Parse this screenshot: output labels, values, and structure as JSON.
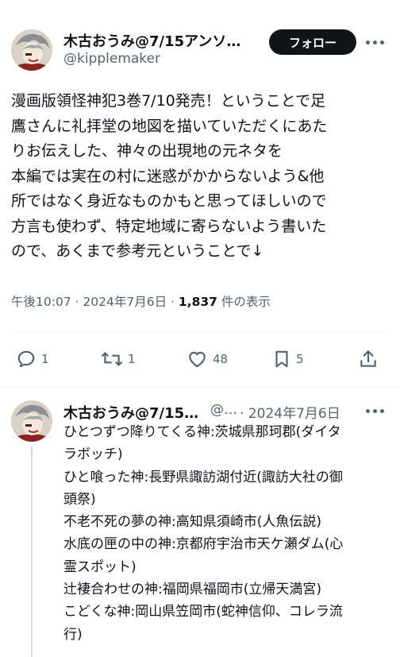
{
  "tweet": {
    "author_name": "木古おうみ@7/15アンソ…",
    "author_handle": "@kipplemaker",
    "follow_label": "フォロー",
    "text_lines": [
      "漫画版領怪神犯3巻7/10発売！ということで足",
      "鷹さんに礼拝堂の地図を描いていただくにあた",
      "りお伝えした、神々の出現地の元ネタを",
      "本編では実在の村に迷惑がかからないよう&他",
      "所ではなく身近なものかもと思ってほしいので",
      "方言も使わず、特定地域に寄らないよう書いた",
      "ので、あくまで参考元ということで↓"
    ],
    "timestamp": "午後10:07 · 2024年7月6日 ·",
    "views_count": "1,837",
    "views_label": "件の表示",
    "stats": {
      "replies": "1",
      "retweets": "1",
      "likes": "48",
      "bookmarks": "5"
    }
  },
  "reply": {
    "author_name": "木古おうみ@7/15…",
    "author_handle": "@…",
    "date": "· 2024年7月6日",
    "text_lines": [
      "ひとつずつ降りてくる神:茨城県那珂郡(ダイタ",
      "ラボッチ)",
      "ひと喰った神:長野県諏訪湖付近(諏訪大社の御",
      "頭祭)",
      "不老不死の夢の神:高知県須崎市(人魚伝説)",
      "水底の匣の中の神:京都府宇治市天ケ瀬ダム(心",
      "霊スポット)",
      "辻褄合わせの神:福岡県福岡市(立帰天満宮)",
      "こどくな神:岡山県笠岡市(蛇神信仰、コレラ流",
      "行)"
    ]
  },
  "icons": [
    "avatar",
    "more-icon",
    "reply-icon",
    "retweet-icon",
    "like-icon",
    "bookmark-icon",
    "share-icon"
  ],
  "colors": {
    "text": "#0f1419",
    "secondary": "#536471",
    "divider": "#eff3f4",
    "follow_bg": "#0f1419"
  }
}
